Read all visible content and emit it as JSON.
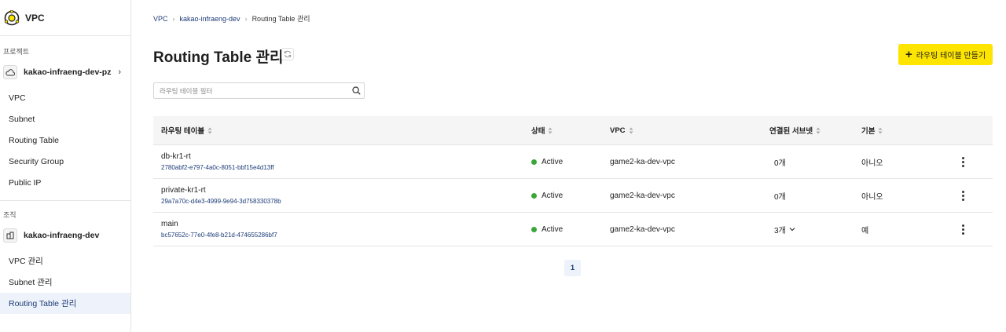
{
  "sidebar": {
    "title": "VPC",
    "project_label": "프로젝트",
    "project_name": "kakao-infraeng-dev-pz",
    "project_items": [
      {
        "label": "VPC"
      },
      {
        "label": "Subnet"
      },
      {
        "label": "Routing Table"
      },
      {
        "label": "Security Group"
      },
      {
        "label": "Public IP"
      }
    ],
    "org_label": "조직",
    "org_name": "kakao-infraeng-dev",
    "org_items": [
      {
        "label": "VPC 관리"
      },
      {
        "label": "Subnet 관리"
      },
      {
        "label": "Routing Table 관리"
      }
    ]
  },
  "breadcrumb": [
    "VPC",
    "kakao-infraeng-dev",
    "Routing Table 관리"
  ],
  "page_title": "Routing Table 관리",
  "create_button": "라우팅 테이블 만들기",
  "filter_placeholder": "라우팅 테이블 필터",
  "table": {
    "columns": [
      "라우팅 테이블",
      "상태",
      "VPC",
      "연결된 서브넷",
      "기본"
    ],
    "rows": [
      {
        "name": "db-kr1-rt",
        "id": "2780abf2-e797-4a0c-8051-bbf15e4d13ff",
        "status": "Active",
        "vpc": "game2-ka-dev-vpc",
        "subnets": "0개",
        "default": "아니오"
      },
      {
        "name": "private-kr1-rt",
        "id": "29a7a70c-d4e3-4999-9e94-3d758330378b",
        "status": "Active",
        "vpc": "game2-ka-dev-vpc",
        "subnets": "0개",
        "default": "아니오"
      },
      {
        "name": "main",
        "id": "bc57652c-77e0-4fe8-b21d-474655286bf7",
        "status": "Active",
        "vpc": "game2-ka-dev-vpc",
        "subnets": "3개",
        "default": "예"
      }
    ]
  },
  "pagination": {
    "current": "1"
  },
  "colors": {
    "accent": "#fee500",
    "link": "#1d3c78",
    "active_status": "#3aa63a",
    "nav_active_bg": "#eef2fa"
  },
  "icons": {
    "logo": "vpc-logo-icon",
    "refresh": "refresh-icon",
    "search": "search-icon",
    "plus": "plus-icon",
    "sort": "sort-icon",
    "more": "more-vertical-icon"
  }
}
